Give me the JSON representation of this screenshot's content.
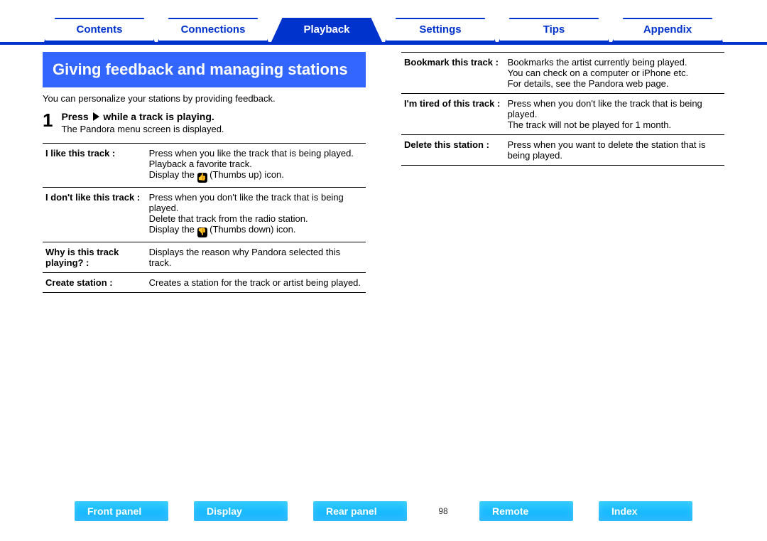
{
  "top_tabs": {
    "items": [
      {
        "label": "Contents"
      },
      {
        "label": "Connections"
      },
      {
        "label": "Playback"
      },
      {
        "label": "Settings"
      },
      {
        "label": "Tips"
      },
      {
        "label": "Appendix"
      }
    ],
    "active_index": 2
  },
  "left": {
    "heading": "Giving feedback and managing stations",
    "intro": "You can personalize your stations by providing feedback.",
    "step_num": "1",
    "step_press": "Press",
    "step_while": "while a track is playing.",
    "step_sub": "The Pandora menu screen is displayed.",
    "rows": [
      {
        "label": "I like this track :",
        "desc_a": "Press when you like the track that is being played.",
        "desc_b": "Playback a favorite track.",
        "desc_c_pre": "Display the ",
        "desc_c_post": " (Thumbs up) icon.",
        "icon": "👍"
      },
      {
        "label": "I don't like this track :",
        "desc_a": "Press when you don't like the track that is being played.",
        "desc_b": "Delete that track from the radio station.",
        "desc_c_pre": "Display the ",
        "desc_c_post": " (Thumbs down) icon.",
        "icon": "👎"
      },
      {
        "label": "Why is this track playing? :",
        "desc_a": "Displays the reason why Pandora selected this track."
      },
      {
        "label": "Create station :",
        "desc_a": "Creates a station for the track or artist being played."
      }
    ]
  },
  "right": {
    "rows": [
      {
        "label": "Bookmark this track :",
        "desc_a": "Bookmarks the artist currently being played.",
        "desc_b": "You can check on a computer or iPhone etc.",
        "desc_c": "For details, see the Pandora web page."
      },
      {
        "label": "I'm tired of this track :",
        "desc_a": "Press when you don't like the track that is being played.",
        "desc_b": "The track will not be played for 1 month."
      },
      {
        "label": "Delete this station :",
        "desc_a": "Press when you want to delete the station that is being played."
      }
    ]
  },
  "bottom": {
    "items": [
      {
        "label": "Front panel"
      },
      {
        "label": "Display"
      },
      {
        "label": "Rear panel"
      },
      {
        "label": "Remote"
      },
      {
        "label": "Index"
      }
    ],
    "page": "98"
  }
}
